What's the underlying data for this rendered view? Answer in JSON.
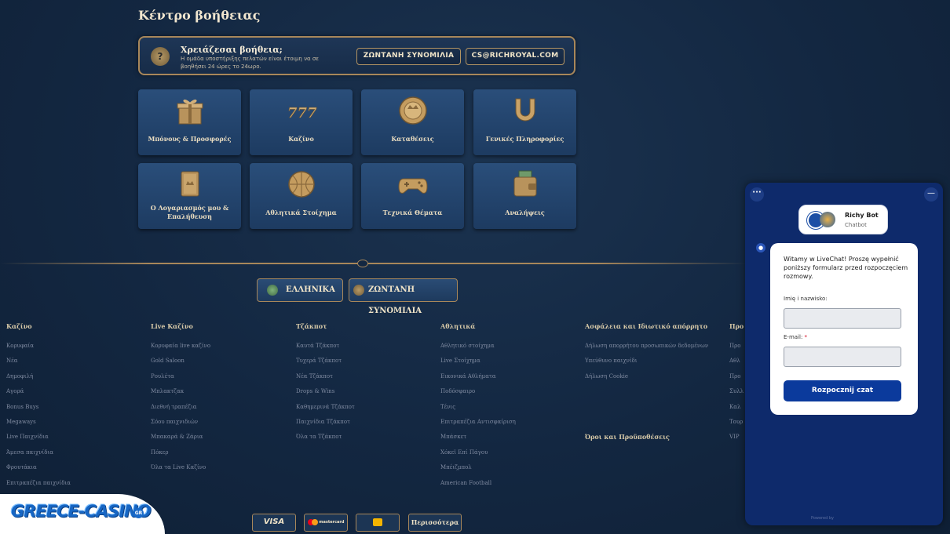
{
  "help_center": {
    "title": "Κέντρο βοήθειας",
    "banner_title": "Χρειάζεσαι βοήθεια;",
    "banner_text": "Η ομάδα υποστήριξης πελατών είναι έτοιμη να σε βοηθήσει 24 ώρες το 24ωρο.",
    "live_chat_label": "ΖΩΝΤΑΝΗ ΣΥΝΟΜΙΛΙΑ",
    "email_label": "CS@RICHROYAL.COM"
  },
  "categories": [
    {
      "label": "Μπόνους & Προσφορές",
      "icon": "gift-icon"
    },
    {
      "label": "Καζίνο",
      "icon": "777-icon"
    },
    {
      "label": "Καταθέσεις",
      "icon": "coin-icon"
    },
    {
      "label": "Γενικές Πληροφορίες",
      "icon": "horseshoe-icon"
    },
    {
      "label": "Ο Λογαριασμός μου & Επαλήθευση",
      "icon": "book-icon"
    },
    {
      "label": "Αθλητικά Στοίχημα",
      "icon": "ball-icon"
    },
    {
      "label": "Τεχνικά Θέματα",
      "icon": "gamepad-icon"
    },
    {
      "label": "Αναλήψεις",
      "icon": "wallet-icon"
    }
  ],
  "footer_buttons": {
    "language": "ΕΛΛΗΝΙΚΑ",
    "live_chat": "ΖΩΝΤΑΝΗ ΣΥΝΟΜΙΛΙΑ"
  },
  "footer_columns": [
    {
      "heading": "Καζίνο",
      "links": [
        "Κορυφαία",
        "Νέα",
        "Δημοφιλή",
        "Αγορά",
        "Bonus Buys",
        "Megaways",
        "Live Παιχνίδια",
        "Άμεσα παιχνίδια",
        "Φρουτάκια",
        "Επιτραπέζια παιχνίδια"
      ]
    },
    {
      "heading": "Live Καζίνο",
      "links": [
        "Κορυφαία live καζίνο",
        "Gold Saloon",
        "Ρουλέτα",
        "Μπλακτζακ",
        "Διεθνή τραπέζια",
        "Σόου παιχνιδιών",
        "Μπακαρά & Ζάρια",
        "Πόκερ",
        "Όλα τα Live Καζίνο"
      ]
    },
    {
      "heading": "Τζάκποτ",
      "links": [
        "Καυτά Τζάκποτ",
        "Τυχερά Τζάκποτ",
        "Νέα Τζάκποτ",
        "Drops & Wins",
        "Καθημερινά Τζάκποτ",
        "Παιχνίδια Τζάκποτ",
        "Όλα τα Τζάκποτ"
      ]
    },
    {
      "heading": "Αθλητικά",
      "links": [
        "Αθλητικό στοίχημα",
        "Live Στοίχημα",
        "Εικονικά Αθλήματα",
        "Ποδόσφαιρο",
        "Τένις",
        "Επιτραπέζια Αντισφαίριση",
        "Μπάσκετ",
        "Χόκεϊ Επί Πάγου",
        "Μπέιζμπολ",
        "American Football"
      ]
    },
    {
      "heading": "Ασφάλεια και Ιδιωτικό απόρρητο",
      "links": [
        "Δήλωση απορρήτου προσωπικών δεδομένων",
        "Υπεύθυνο παιχνίδι",
        "Δήλωση Cookie"
      ]
    },
    {
      "heading": "Προ",
      "links": [
        "Προ",
        "Αθλ",
        "Προ",
        "Συλλ",
        "Καλ",
        "Τουρ",
        "VIP"
      ]
    }
  ],
  "terms_heading": "Όροι και Προϋποθέσεις",
  "payments": {
    "visa": "VISA",
    "mastercard": "mastercard",
    "more": "Περισσότερα"
  },
  "logo": {
    "text": "GREECE-CASINO",
    "badge": "GR"
  },
  "chat": {
    "bot_name": "Richy Bot",
    "bot_role": "Chatbot",
    "intro": "Witamy w LiveChat! Proszę wypełnić poniższy formularz przed rozpoczęciem rozmowy.",
    "name_label": "Imię i nazwisko:",
    "email_label": "E-mail:",
    "required_mark": "*",
    "start_button": "Rozpocznij czat",
    "powered_by": "Powered by"
  },
  "colors": {
    "gold": "#a8875a",
    "navy": "#132741",
    "chat_blue": "#0e2a6b",
    "start_button": "#0b3a9c"
  }
}
